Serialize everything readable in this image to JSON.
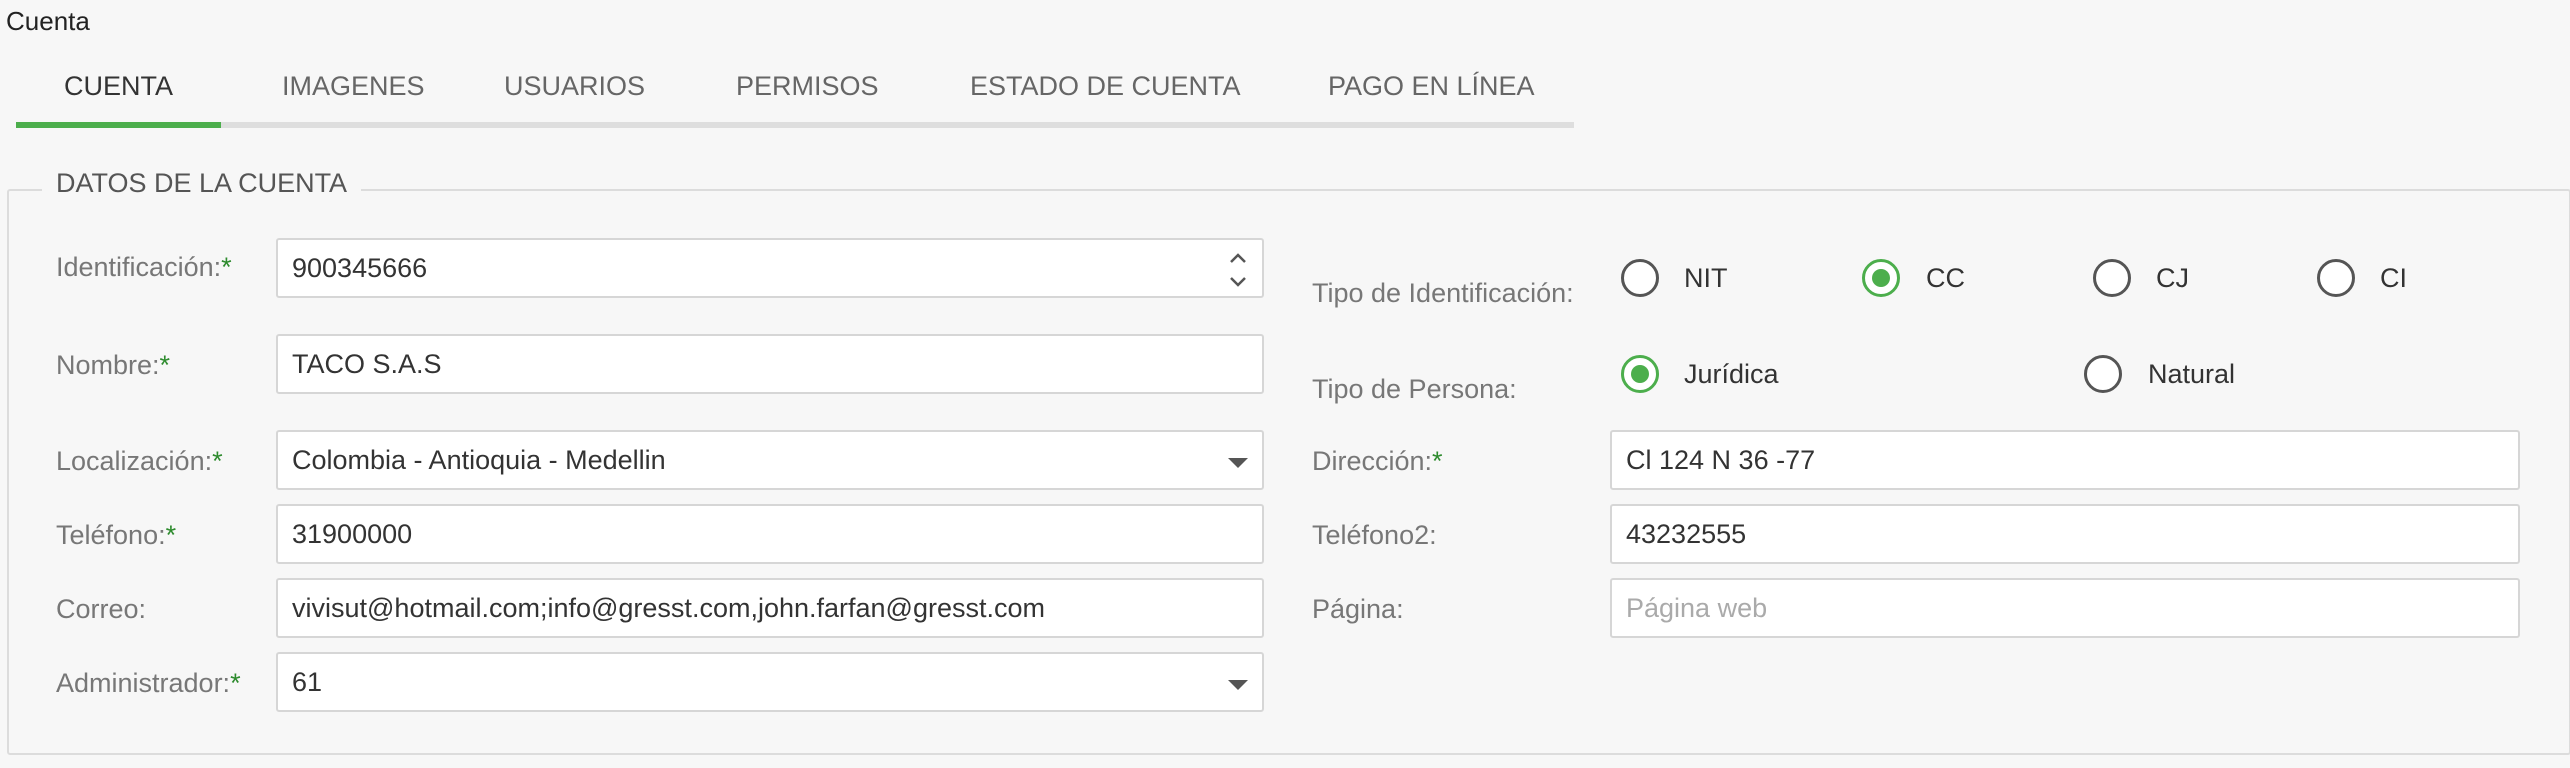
{
  "page": {
    "title": "Cuenta"
  },
  "tabs": [
    {
      "label": "CUENTA",
      "active": true
    },
    {
      "label": "IMAGENES",
      "active": false
    },
    {
      "label": "USUARIOS",
      "active": false
    },
    {
      "label": "PERMISOS",
      "active": false
    },
    {
      "label": "ESTADO DE CUENTA",
      "active": false
    },
    {
      "label": "PAGO EN LÍNEA",
      "active": false
    }
  ],
  "section": {
    "legend": "DATOS DE LA CUENTA"
  },
  "required_marker": "*",
  "form": {
    "identificacion": {
      "label": "Identificación:",
      "value": "900345666"
    },
    "nombre": {
      "label": "Nombre:",
      "value": "TACO S.A.S"
    },
    "localizacion": {
      "label": "Localización:",
      "value": "Colombia - Antioquia - Medellin"
    },
    "telefono": {
      "label": "Teléfono:",
      "value": "31900000"
    },
    "correo": {
      "label": "Correo:",
      "value": "vivisut@hotmail.com;info@gresst.com,john.farfan@gresst.com"
    },
    "administrador": {
      "label": "Administrador:",
      "value": "61"
    },
    "tipo_identificacion": {
      "label": "Tipo de Identificación:",
      "options": [
        "NIT",
        "CC",
        "CJ",
        "CI"
      ],
      "selected": "CC"
    },
    "tipo_persona": {
      "label": "Tipo de Persona:",
      "options": [
        "Jurídica",
        "Natural"
      ],
      "selected": "Jurídica"
    },
    "direccion": {
      "label": "Dirección:",
      "value": "Cl 124 N 36 -77"
    },
    "telefono2": {
      "label": "Teléfono2:",
      "value": "43232555"
    },
    "pagina": {
      "label": "Página:",
      "value": "",
      "placeholder": "Página web"
    }
  },
  "colors": {
    "accent": "#4cae4c",
    "required": "#2e8b2e"
  },
  "icons": {
    "select_caret": "chevron-down-icon",
    "number_spinner": "spinner-icon"
  }
}
